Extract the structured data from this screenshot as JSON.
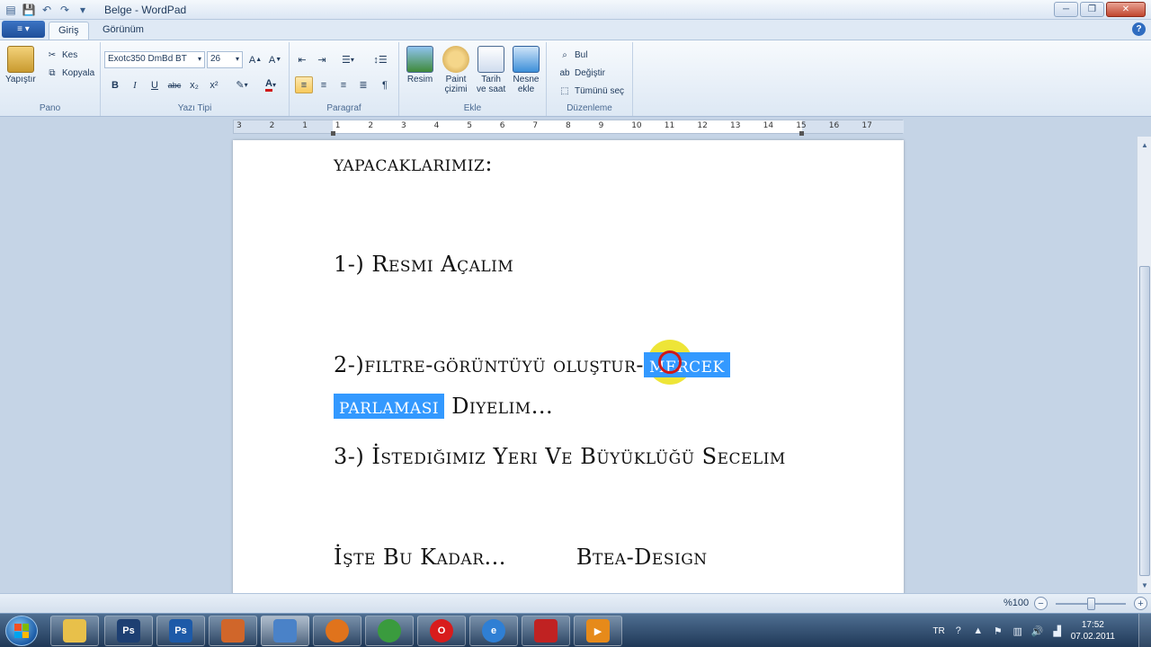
{
  "window": {
    "title": "Belge - WordPad",
    "minimize": "─",
    "maximize": "❐",
    "close": "✕"
  },
  "tabs": {
    "app_menu": "≡ ▾",
    "home": "Giriş",
    "view": "Görünüm"
  },
  "ribbon": {
    "clipboard": {
      "paste": "Yapıştır",
      "cut": "Kes",
      "copy": "Kopyala",
      "label": "Pano"
    },
    "font": {
      "name": "Exotc350 DmBd BT",
      "size": "26",
      "label": "Yazı Tipi",
      "bold": "B",
      "italic": "I",
      "underline": "U",
      "strike": "abc",
      "sub": "x₂",
      "sup": "x²"
    },
    "paragraph": {
      "label": "Paragraf"
    },
    "insert": {
      "picture": "Resim",
      "paint1": "Paint",
      "paint2": "çizimi",
      "date1": "Tarih",
      "date2": "ve saat",
      "object1": "Nesne",
      "object2": "ekle",
      "label": "Ekle"
    },
    "editing": {
      "find": "Bul",
      "replace": "Değiştir",
      "select_all": "Tümünü seç",
      "label": "Düzenleme"
    }
  },
  "ruler": [
    "3",
    "2",
    "1",
    "1",
    "2",
    "3",
    "4",
    "5",
    "6",
    "7",
    "8",
    "9",
    "10",
    "11",
    "12",
    "13",
    "14",
    "15",
    "16",
    "17"
  ],
  "document": {
    "line1": "yapacaklarımız:",
    "line2": "1-) Resmi Açalım",
    "line3a": "2-)filtre-görüntüyü oluştur-",
    "line3b": "mercek",
    "line4a": "parlaması",
    "line4b": " Diyelim...",
    "line5": "3-) İstediğimiz Yeri Ve Büyüklüğü Secelim",
    "line6a": "İşte Bu Kadar...",
    "line6b": "Btea-Design"
  },
  "status": {
    "zoom": "%100",
    "zoom_out": "−",
    "zoom_in": "+",
    "zoom_level": 0.5
  },
  "taskbar": {
    "apps": [
      {
        "name": "explorer",
        "label": "",
        "color": "#e8c04a"
      },
      {
        "name": "photoshop-1",
        "label": "Ps",
        "color": "#1d3f72"
      },
      {
        "name": "photoshop-2",
        "label": "Ps",
        "color": "#1d5aa8"
      },
      {
        "name": "app-loader",
        "label": "",
        "color": "#d0662a"
      },
      {
        "name": "wordpad",
        "label": "",
        "color": "#4a82c8"
      },
      {
        "name": "firefox",
        "label": "",
        "color": "#e0731c"
      },
      {
        "name": "chrome",
        "label": "",
        "color": "#3a9b3e"
      },
      {
        "name": "opera",
        "label": "O",
        "color": "#d81c1c"
      },
      {
        "name": "internet-explorer",
        "label": "e",
        "color": "#2f7fd4"
      },
      {
        "name": "ccleaner",
        "label": "",
        "color": "#c02222"
      },
      {
        "name": "media-player",
        "label": "▶",
        "color": "#e68a1a"
      }
    ],
    "lang": "TR",
    "time": "17:52",
    "date": "07.02.2011"
  }
}
